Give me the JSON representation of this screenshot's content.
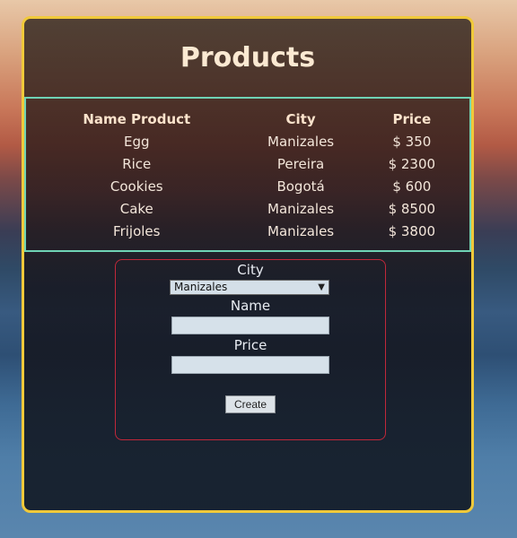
{
  "page": {
    "title": "Products"
  },
  "table": {
    "headers": [
      "Name Product",
      "City",
      "Price"
    ],
    "rows": [
      [
        "Egg",
        "Manizales",
        "$ 350"
      ],
      [
        "Rice",
        "Pereira",
        "$ 2300"
      ],
      [
        "Cookies",
        "Bogotá",
        "$ 600"
      ],
      [
        "Cake",
        "Manizales",
        "$ 8500"
      ],
      [
        "Frijoles",
        "Manizales",
        "$ 3800"
      ]
    ]
  },
  "form": {
    "city_label": "City",
    "city_selected": "Manizales",
    "name_label": "Name",
    "name_value": "",
    "price_label": "Price",
    "price_value": "",
    "submit_label": "Create"
  },
  "colors": {
    "card_border": "#f0c93a",
    "table_border": "#6fd3b5",
    "form_border": "#c0283a"
  }
}
